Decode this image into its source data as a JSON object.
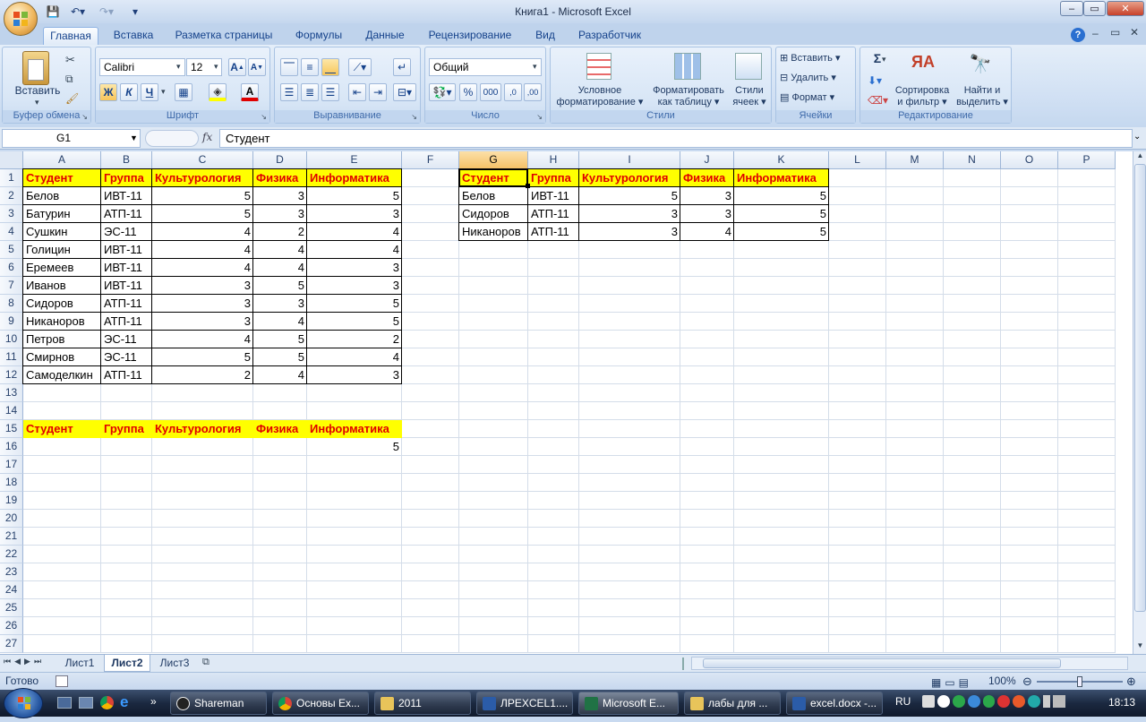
{
  "window": {
    "title": "Книга1 - Microsoft Excel"
  },
  "ribbon_tabs": [
    "Главная",
    "Вставка",
    "Разметка страницы",
    "Формулы",
    "Данные",
    "Рецензирование",
    "Вид",
    "Разработчик"
  ],
  "ribbon": {
    "clipboard": {
      "label": "Буфер обмена",
      "paste": "Вставить"
    },
    "font": {
      "label": "Шрифт",
      "name": "Calibri",
      "size": "12",
      "bold": "Ж",
      "italic": "К",
      "underline": "Ч"
    },
    "alignment": {
      "label": "Выравнивание"
    },
    "number": {
      "label": "Число",
      "format": "Общий",
      "percent": "%",
      "thousands": "000"
    },
    "styles": {
      "label": "Стили",
      "cond1": "Условное",
      "cond2": "форматирование",
      "table1": "Форматировать",
      "table2": "как таблицу",
      "cell1": "Стили",
      "cell2": "ячеек"
    },
    "cells": {
      "label": "Ячейки",
      "insert": "Вставить",
      "delete": "Удалить",
      "format": "Формат"
    },
    "editing": {
      "label": "Редактирование",
      "sum": "Σ",
      "sort1": "Сортировка",
      "sort2": "и фильтр",
      "find1": "Найти и",
      "find2": "выделить"
    }
  },
  "formula_bar": {
    "name_box": "G1",
    "fx": "fx",
    "content": "Студент"
  },
  "columns": [
    "A",
    "B",
    "C",
    "D",
    "E",
    "F",
    "G",
    "H",
    "I",
    "J",
    "K",
    "L",
    "M",
    "N",
    "O",
    "P"
  ],
  "rows": [
    "1",
    "2",
    "3",
    "4",
    "5",
    "6",
    "7",
    "8",
    "9",
    "10",
    "11",
    "12",
    "13",
    "14",
    "15",
    "16",
    "17",
    "18",
    "19",
    "20",
    "21",
    "22",
    "23",
    "24",
    "25",
    "26",
    "27"
  ],
  "table1": {
    "headers": [
      "Студент",
      "Группа",
      "Культурология",
      "Физика",
      "Информатика"
    ],
    "rows": [
      [
        "Белов",
        "ИВТ-11",
        "5",
        "3",
        "5"
      ],
      [
        "Батурин",
        "АТП-11",
        "5",
        "3",
        "3"
      ],
      [
        "Сушкин",
        "ЭС-11",
        "4",
        "2",
        "4"
      ],
      [
        "Голицин",
        "ИВТ-11",
        "4",
        "4",
        "4"
      ],
      [
        "Еремеев",
        "ИВТ-11",
        "4",
        "4",
        "3"
      ],
      [
        "Иванов",
        "ИВТ-11",
        "3",
        "5",
        "3"
      ],
      [
        "Сидоров",
        "АТП-11",
        "3",
        "3",
        "5"
      ],
      [
        "Никаноров",
        "АТП-11",
        "3",
        "4",
        "5"
      ],
      [
        "Петров",
        "ЭС-11",
        "4",
        "5",
        "2"
      ],
      [
        "Смирнов",
        "ЭС-11",
        "5",
        "5",
        "4"
      ],
      [
        "Самоделкин",
        "АТП-11",
        "2",
        "4",
        "3"
      ]
    ]
  },
  "criteria": {
    "headers": [
      "Студент",
      "Группа",
      "Культурология",
      "Физика",
      "Информатика"
    ],
    "row16_e": "5"
  },
  "result": {
    "headers": [
      "Студент",
      "Группа",
      "Культурология",
      "Физика",
      "Информатика"
    ],
    "rows": [
      [
        "Белов",
        "ИВТ-11",
        "5",
        "3",
        "5"
      ],
      [
        "Сидоров",
        "АТП-11",
        "3",
        "3",
        "5"
      ],
      [
        "Никаноров",
        "АТП-11",
        "3",
        "4",
        "5"
      ]
    ]
  },
  "sheets": [
    "Лист1",
    "Лист2",
    "Лист3"
  ],
  "active_sheet": "Лист2",
  "status": {
    "ready": "Готово",
    "zoom": "100%"
  },
  "taskbar": {
    "items": [
      "Shareman",
      "Основы Ex...",
      "2011",
      "ЛРEXCEL1....",
      "Microsoft E...",
      "лабы для ...",
      "excel.docx -..."
    ],
    "lang": "RU",
    "clock": "18:13"
  }
}
